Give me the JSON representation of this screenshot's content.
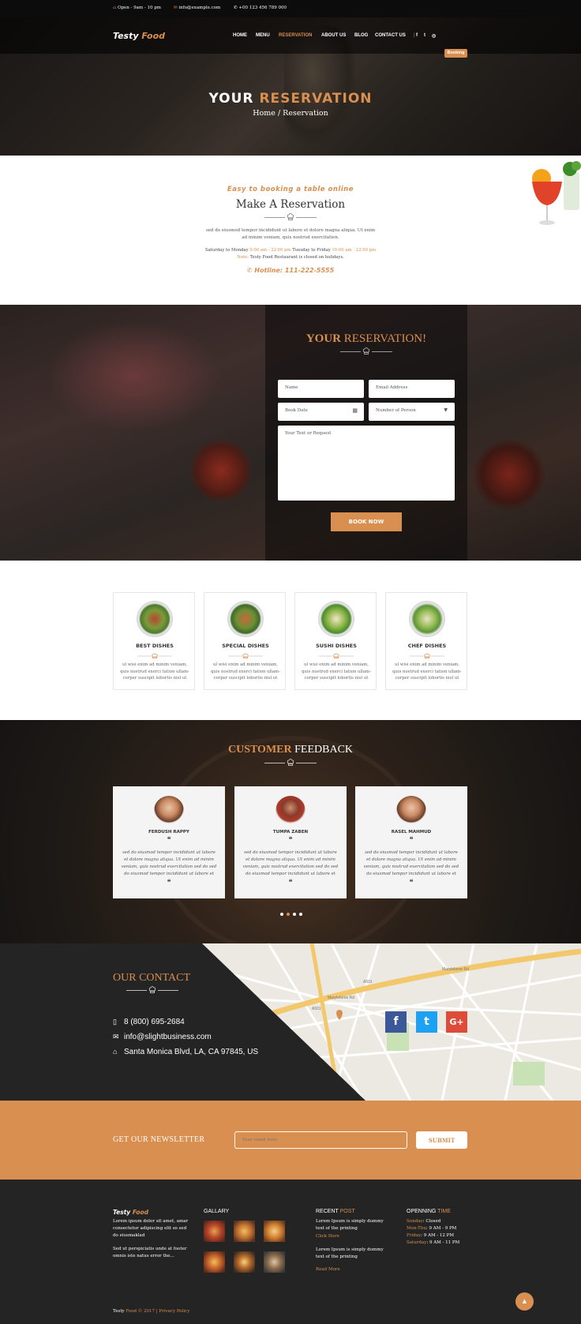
{
  "topbar": {
    "hours": "Open - 9am - 10 pm",
    "email": "info@example.com",
    "phone": "+00 123 456 789 000"
  },
  "brand": {
    "logo_a": "Testy",
    "logo_b": "Food",
    "accent": "#d98f4f"
  },
  "nav": {
    "items": [
      "HOME",
      "MENU",
      "RESERVATION",
      "ABOUT US",
      "BLOG",
      "CONTACT US"
    ],
    "booking": "Booking"
  },
  "hero": {
    "title_a": "YOUR",
    "title_b": "RESERVATION",
    "crumb_home": "Home",
    "crumb_sep": "/",
    "crumb_current": "Reservation"
  },
  "intro": {
    "subtitle": "Easy to booking a table online",
    "title": "Make A Reservation",
    "text": "sed do eiusmod tempor incididunt ut labore et dolore magna aliqua. Ut enim ad minim veniam, quis nostrud exercitation.",
    "days1": "Saturday to Monday",
    "time1": "9:00 am - 22:00 pm",
    "days2": "Tuesday to Friday",
    "time2": "10:00 am - 22:00 pm",
    "note_label": "Note:",
    "note_text": "Testy Food Restaurant is closed on holidays.",
    "hotline": "Hotline: 111-222-5555"
  },
  "reservation": {
    "title_a": "YOUR",
    "title_b": "RESERVATION!",
    "name_ph": "Name",
    "email_ph": "Email Address",
    "date_ph": "Book Date",
    "persons_ph": "Number of Person",
    "request_ph": "Your Text or Request",
    "submit": "BOOK NOW"
  },
  "dishes": [
    {
      "name": "BEST DISHES",
      "desc": "ul wisi enim ad minim veniam, quis nostrud exerci tation ullam-corper suscipit lobortis nisl ut"
    },
    {
      "name": "SPECIAL DISHES",
      "desc": "ul wisi enim ad minim veniam, quis nostrud exerci tation ullam-corper suscipit lobortis nisl ut"
    },
    {
      "name": "SUSHI DISHES",
      "desc": "ul wisi enim ad minim veniam, quis nostrud exerci tation ullam-corper suscipit lobortis nisl ut"
    },
    {
      "name": "CHEF DISHES",
      "desc": "ul wisi enim ad minim veniam, quis nostrud exerci tation ullam-corper suscipit lobortis nisl ut"
    }
  ],
  "feedback": {
    "title_a": "CUSTOMER",
    "title_b": "FEEDBACK",
    "reviews": [
      {
        "name": "FERDUSH RAPPY",
        "text": "sed do eiusmod tempor incididunt ut labore et dolore magna aliqua. Ut enim ad minim veniam, quis nostrud exercitation sed do sed do eiusmod tempor incididunt ut labore et"
      },
      {
        "name": "TUMPA ZABEN",
        "text": "sed do eiusmod tempor incididunt ut labore et dolore magna aliqua. Ut enim ad minim veniam, quis nostrud exercitation sed do sed do eiusmod tempor incididunt ut labore et"
      },
      {
        "name": "RASEL MAHMUD",
        "text": "sed do eiusmod tempor incididunt ut labore et dolore magna aliqua. Ut enim ad minim veniam, quis nostrud exercitation sed do sed do eiusmod tempor incididunt ut labore et"
      }
    ],
    "quote": "❝"
  },
  "contact": {
    "title_a": "OUR",
    "title_b": "CONTACT",
    "phone": "8 (800) 695-2684",
    "email": "info@slightbusiness.com",
    "address": "Santa Monica Blvd, LA, CA 97845, US",
    "social": [
      "f",
      "t",
      "G+"
    ],
    "social_colors": [
      "#3b5998",
      "#1da1f2",
      "#dd4b39"
    ],
    "map_labels": [
      "Marylebone Rd",
      "Marylebone Rd",
      "A501",
      "A501"
    ]
  },
  "newsletter": {
    "title": "GET OUR NEWSLETTER",
    "placeholder": "Your email here",
    "submit": "SUBMIT"
  },
  "footer": {
    "about": "Lorem ipsum dolor sit amet, amar consectetur adipiscing elit so sed do eiusmaklad",
    "about2": "Sed ut perspiciatis unde at footer omnis iste natus error the...",
    "gallery_title": "GALLARY",
    "recent_a": "RECENT",
    "recent_b": "POST",
    "post1": "Lorem Ipsum is simply dummy text of the printing",
    "post1_link": "Click Here",
    "post2": "Lorem Ipsum is simply dummy text of the printing",
    "post2_link": "Read More",
    "opening_a": "OPENNING",
    "opening_b": "TIME",
    "hours": [
      {
        "day": "Sunday",
        "time": ": Closed"
      },
      {
        "day": "Mon-Thu",
        "time": ": 9 AM - 9 PM"
      },
      {
        "day": "Friday",
        "time": ": 9 AM - 12 PM"
      },
      {
        "day": "Saturday",
        "time": ": 9 AM - 11 PM"
      }
    ],
    "copy_a": "Testy",
    "copy_b": "Food © 2017",
    "copy_sep": "|",
    "privacy": "Privacy Policy",
    "totop": "▲"
  }
}
